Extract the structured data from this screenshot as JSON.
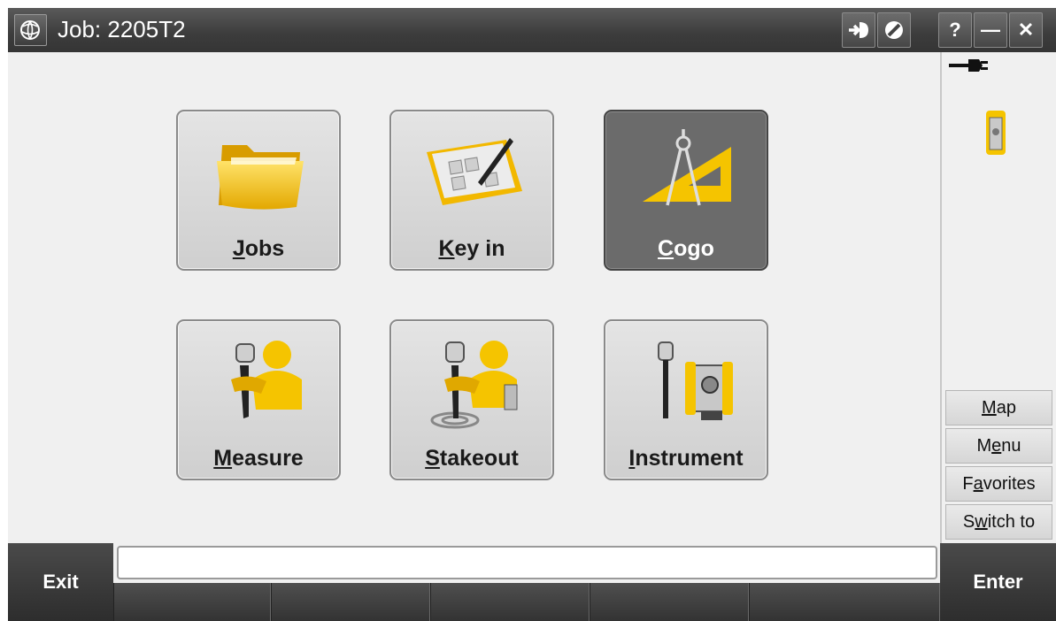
{
  "titlebar": {
    "title": "Job: 2205T2",
    "logo_icon": "trimble-globe-icon",
    "buttons": [
      {
        "name": "connect-button",
        "icon": "arrow-in-icon"
      },
      {
        "name": "disconnect-button",
        "icon": "prohibited-icon"
      },
      {
        "name": "help-button",
        "label": "?"
      },
      {
        "name": "minimize-button",
        "label": "—"
      },
      {
        "name": "close-button",
        "label": "✕"
      }
    ]
  },
  "tiles": [
    {
      "id": "jobs",
      "label": "Jobs",
      "mnemonic": "J",
      "rest": "obs",
      "icon": "folder-icon",
      "selected": false
    },
    {
      "id": "key-in",
      "label": "Key in",
      "mnemonic": "K",
      "rest": "ey in",
      "icon": "keyboard-notepad-icon",
      "selected": false
    },
    {
      "id": "cogo",
      "label": "Cogo",
      "mnemonic": "C",
      "rest": "ogo",
      "icon": "compass-triangle-icon",
      "selected": true
    },
    {
      "id": "measure",
      "label": "Measure",
      "mnemonic": "M",
      "rest": "easure",
      "icon": "surveyor-pole-icon",
      "selected": false
    },
    {
      "id": "stakeout",
      "label": "Stakeout",
      "mnemonic": "S",
      "rest": "takeout",
      "icon": "surveyor-target-icon",
      "selected": false
    },
    {
      "id": "instrument",
      "label": "Instrument",
      "mnemonic": "I",
      "rest": "nstrument",
      "icon": "total-station-icon",
      "selected": false
    }
  ],
  "status_icons": {
    "power": "power-plug-icon",
    "instrument": "total-station-small-icon"
  },
  "side_buttons": [
    {
      "id": "map",
      "pre": "",
      "mn": "M",
      "post": "ap"
    },
    {
      "id": "menu",
      "pre": "M",
      "mn": "e",
      "post": "nu"
    },
    {
      "id": "favorites",
      "pre": "F",
      "mn": "a",
      "post": "vorites"
    },
    {
      "id": "switch-to",
      "pre": "S",
      "mn": "w",
      "post": "itch to"
    }
  ],
  "softkeys": {
    "exit": "Exit",
    "enter": "Enter"
  },
  "colors": {
    "accent_yellow": "#f5c400",
    "selected_tile": "#6b6b6b",
    "titlebar": "#404040"
  }
}
